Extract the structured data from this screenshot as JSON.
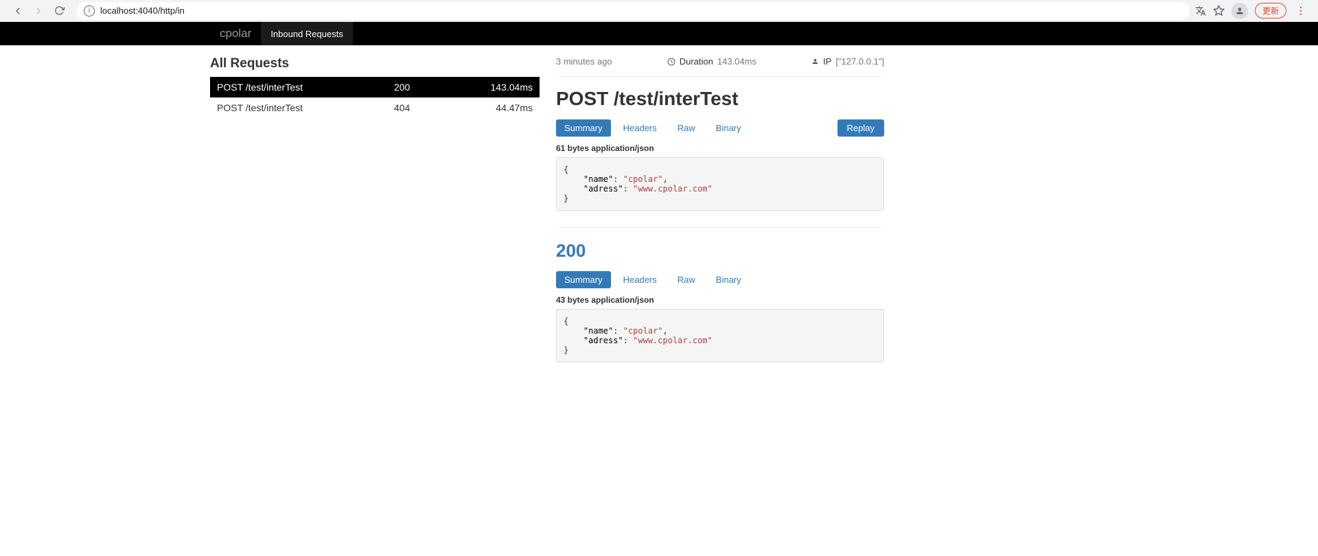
{
  "chrome": {
    "url": "localhost:4040/http/in",
    "update_label": "更新"
  },
  "nav": {
    "brand": "cpolar",
    "item_inbound": "Inbound Requests"
  },
  "left": {
    "title": "All Requests",
    "rows": [
      {
        "method_path": "POST /test/interTest",
        "status": "200",
        "duration": "143.04ms",
        "selected": true
      },
      {
        "method_path": "POST /test/interTest",
        "status": "404",
        "duration": "44.47ms",
        "selected": false
      }
    ]
  },
  "detail": {
    "time_ago": "3 minutes ago",
    "duration_label": "Duration",
    "duration_value": "143.04ms",
    "ip_label": "IP",
    "ip_value": "[\"127.0.0.1\"]",
    "heading": "POST /test/interTest",
    "tabs": {
      "summary": "Summary",
      "headers": "Headers",
      "raw": "Raw",
      "binary": "Binary"
    },
    "replay": "Replay",
    "request": {
      "meta": "61 bytes application/json",
      "json": {
        "name": "cpolar",
        "adress": "www.cpolar.com"
      }
    },
    "response": {
      "status": "200",
      "meta": "43 bytes application/json",
      "json": {
        "name": "cpolar",
        "adress": "www.cpolar.com"
      }
    }
  }
}
